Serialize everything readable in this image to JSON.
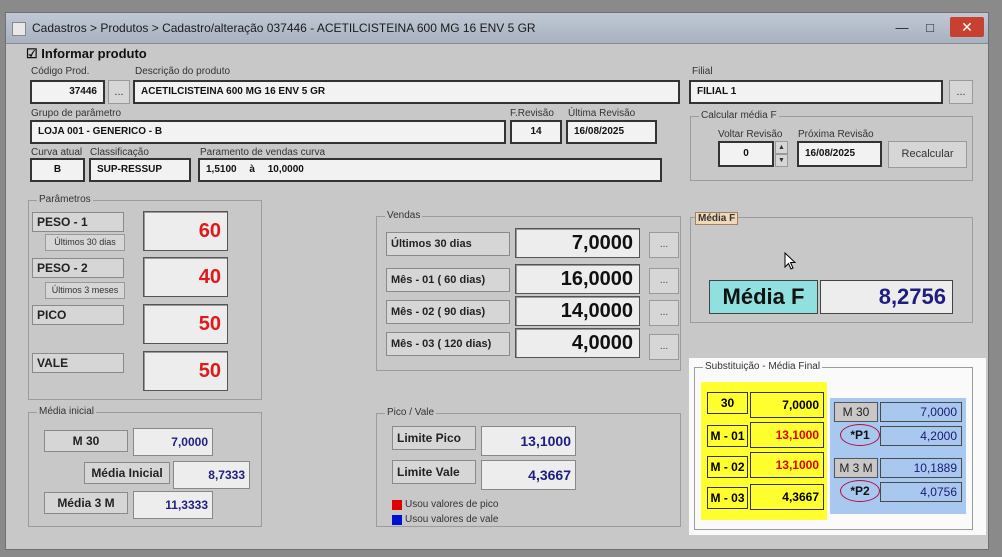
{
  "window": {
    "title": "Cadastros > Produtos > Cadastro/alteração  037446 - ACETILCISTEINA 600 MG 16 ENV 5 GR"
  },
  "informar": {
    "label": "Informar produto",
    "checked": "☑"
  },
  "codigo": {
    "label": "Código Prod.",
    "value": "37446",
    "btn": "..."
  },
  "descricao": {
    "label": "Descrição do  produto",
    "value": "ACETILCISTEINA 600 MG 16 ENV 5 GR"
  },
  "filial": {
    "label": "Filial",
    "value": "FILIAL 1",
    "btn": "..."
  },
  "grupo": {
    "label": "Grupo de parâmetro",
    "value": "LOJA 001 - GENERICO - B"
  },
  "frevisao": {
    "label": "F.Revisão",
    "value": "14"
  },
  "ultima": {
    "label": "Última Revisão",
    "value": "16/08/2025"
  },
  "calcular": {
    "label": "Calcular média F",
    "voltar_label": "Voltar Revisão",
    "voltar_value": "0",
    "proxima_label": "Próxima Revisão",
    "proxima_value": "16/08/2025",
    "recalc": "Recalcular"
  },
  "curva": {
    "label": "Curva atual",
    "value": "B"
  },
  "classificacao": {
    "label": "Classificação",
    "value": "SUP-RESSUP"
  },
  "parcurva": {
    "label": "Paramento de vendas curva",
    "from": "1,5100",
    "sep": "à",
    "to": "10,0000"
  },
  "parametros": {
    "label": "Parâmetros",
    "items": [
      {
        "name": "PESO - 1",
        "sub": "Últimos 30 dias",
        "value": "60"
      },
      {
        "name": "PESO - 2",
        "sub": "Últimos 3 meses",
        "value": "40"
      },
      {
        "name": "PICO",
        "sub": "",
        "value": "50"
      },
      {
        "name": "VALE",
        "sub": "",
        "value": "50"
      }
    ]
  },
  "vendas": {
    "label": "Vendas",
    "rows": [
      {
        "label": "Últimos 30 dias",
        "value": "7,0000",
        "btn": "..."
      },
      {
        "label": "Mês - 01 ( 60 dias)",
        "value": "16,0000",
        "btn": "..."
      },
      {
        "label": "Mês - 02 ( 90 dias)",
        "value": "14,0000",
        "btn": "..."
      },
      {
        "label": "Mês - 03 ( 120 dias)",
        "value": "4,0000",
        "btn": "..."
      }
    ]
  },
  "mediaf": {
    "group": "Média F",
    "label": "Média F",
    "value": "8,2756"
  },
  "mediainicial": {
    "label": "Média inicial",
    "m30_label": "M 30",
    "m30_value": "7,0000",
    "mi_label": "Média Inicial",
    "mi_value": "8,7333",
    "m3m_label": "Média 3 M",
    "m3m_value": "11,3333"
  },
  "picovale": {
    "label": "Pico / Vale",
    "pico_label": "Limite Pico",
    "pico_value": "13,1000",
    "vale_label": "Limite Vale",
    "vale_value": "4,3667",
    "legend_pico": "Usou valores de pico",
    "legend_vale": "Usou valores de vale"
  },
  "substituicao": {
    "label": "Substituição - Média Final",
    "yellow": [
      {
        "label": "30",
        "value": "7,0000",
        "color": "#000000"
      },
      {
        "label": "M - 01",
        "value": "13,1000",
        "color": "#e00000"
      },
      {
        "label": "M - 02",
        "value": "13,1000",
        "color": "#e00000"
      },
      {
        "label": "M - 03",
        "value": "4,3667",
        "color": "#000000"
      }
    ],
    "blue": [
      {
        "label": "M 30",
        "value": "7,0000"
      },
      {
        "label": "*P1",
        "value": "4,2000"
      },
      {
        "label": "M 3 M",
        "value": "10,1889"
      },
      {
        "label": "*P2",
        "value": "4,0756"
      }
    ]
  }
}
